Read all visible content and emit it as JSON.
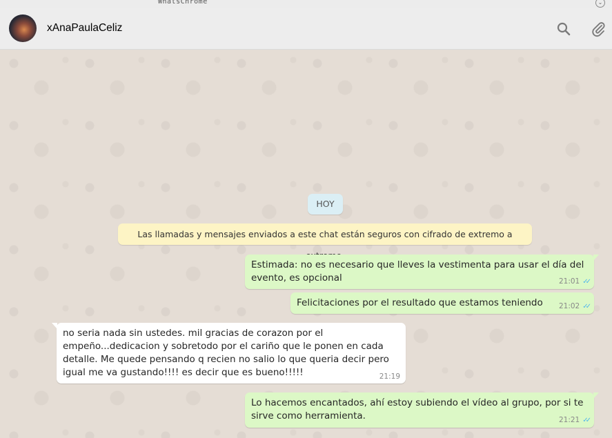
{
  "window": {
    "title": "WhatsChrome"
  },
  "header": {
    "contact_name": "xAnaPaulaCeliz"
  },
  "chat": {
    "date_divider": "HOY",
    "encryption_notice": "Las llamadas y mensajes enviados a este chat están seguros con cifrado de extremo a extremo.",
    "messages": [
      {
        "direction": "out",
        "text": "Estimada: no es necesario que lleves la vestimenta para usar el día del evento, es opcional",
        "time": "21:01",
        "status": "read"
      },
      {
        "direction": "out",
        "text": "Felicitaciones por el resultado que estamos teniendo",
        "time": "21:02",
        "status": "read"
      },
      {
        "direction": "in",
        "text": "no seria nada sin ustedes. mil gracias de corazon por el empeño...dedicacion y sobretodo por el cariño que le ponen en cada detalle. Me quede pensando q recien no salio lo que queria decir pero igual me va gustando!!!! es decir que es bueno!!!!!",
        "time": "21:19"
      },
      {
        "direction": "out",
        "text": "Lo hacemos encantados, ahí estoy subiendo el vídeo al grupo, por si te sirve como herramienta.",
        "time": "21:21",
        "status": "read"
      }
    ]
  },
  "colors": {
    "outgoing_bubble": "#dcf8c6",
    "incoming_bubble": "#ffffff",
    "read_ticks": "#4fb6ec",
    "notice_bg": "#fdf4c5",
    "date_pill_bg": "#dbeff5"
  },
  "icons": [
    "search-icon",
    "attach-icon",
    "dropdown-icon",
    "double-check-icon"
  ]
}
